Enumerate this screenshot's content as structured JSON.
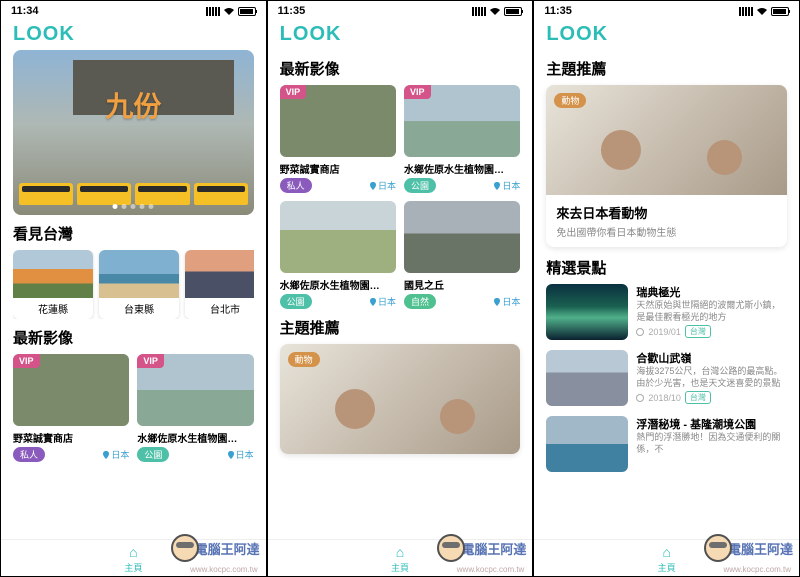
{
  "status_time_1": "11:34",
  "status_time_2": "11:35",
  "status_time_3": "11:35",
  "app_logo": "LOOK",
  "hero_title": "九份",
  "section_taiwan": "看見台灣",
  "section_latest": "最新影像",
  "section_theme": "主題推薦",
  "section_spots": "精選景點",
  "vip_label": "VIP",
  "tag_private": "私人",
  "tag_park": "公園",
  "tag_nature": "自然",
  "tag_animal": "動物",
  "country_jp": "日本",
  "locs": [
    {
      "name": "花蓮縣"
    },
    {
      "name": "台東縣"
    },
    {
      "name": "台北市"
    }
  ],
  "vids": [
    {
      "title": "野菜誠實商店",
      "tag": "私人",
      "tag_cls": "private",
      "country": "日本"
    },
    {
      "title": "水鄉佐原水生植物園…",
      "tag": "公園",
      "tag_cls": "park",
      "country": "日本"
    },
    {
      "title": "水鄉佐原水生植物園…",
      "tag": "公園",
      "tag_cls": "park",
      "country": "日本"
    },
    {
      "title": "國見之丘",
      "tag": "自然",
      "tag_cls": "nature",
      "country": "日本"
    }
  ],
  "theme": {
    "title": "來去日本看動物",
    "desc": "免出國帶你看日本動物生態"
  },
  "spots": [
    {
      "title": "瑞典極光",
      "desc": "天然原始與世隔絕的波爾尤斯小鎮，是最佳觀看極光的地方",
      "date": "2019/01",
      "tag": "台灣"
    },
    {
      "title": "合歡山武嶺",
      "desc": "海拔3275公尺，台灣公路的最高點。由於少光害，也是天文迷喜愛的景點",
      "date": "2018/10",
      "tag": "台灣"
    },
    {
      "title": "浮潛秘境 - 基隆潮境公園",
      "desc": "熱門的浮潛勝地！因為交通便利的關係，不",
      "date": "",
      "tag": ""
    }
  ],
  "tab_home": "主頁",
  "watermark_text": "電腦王阿達",
  "watermark_url": "www.kocpc.com.tw"
}
